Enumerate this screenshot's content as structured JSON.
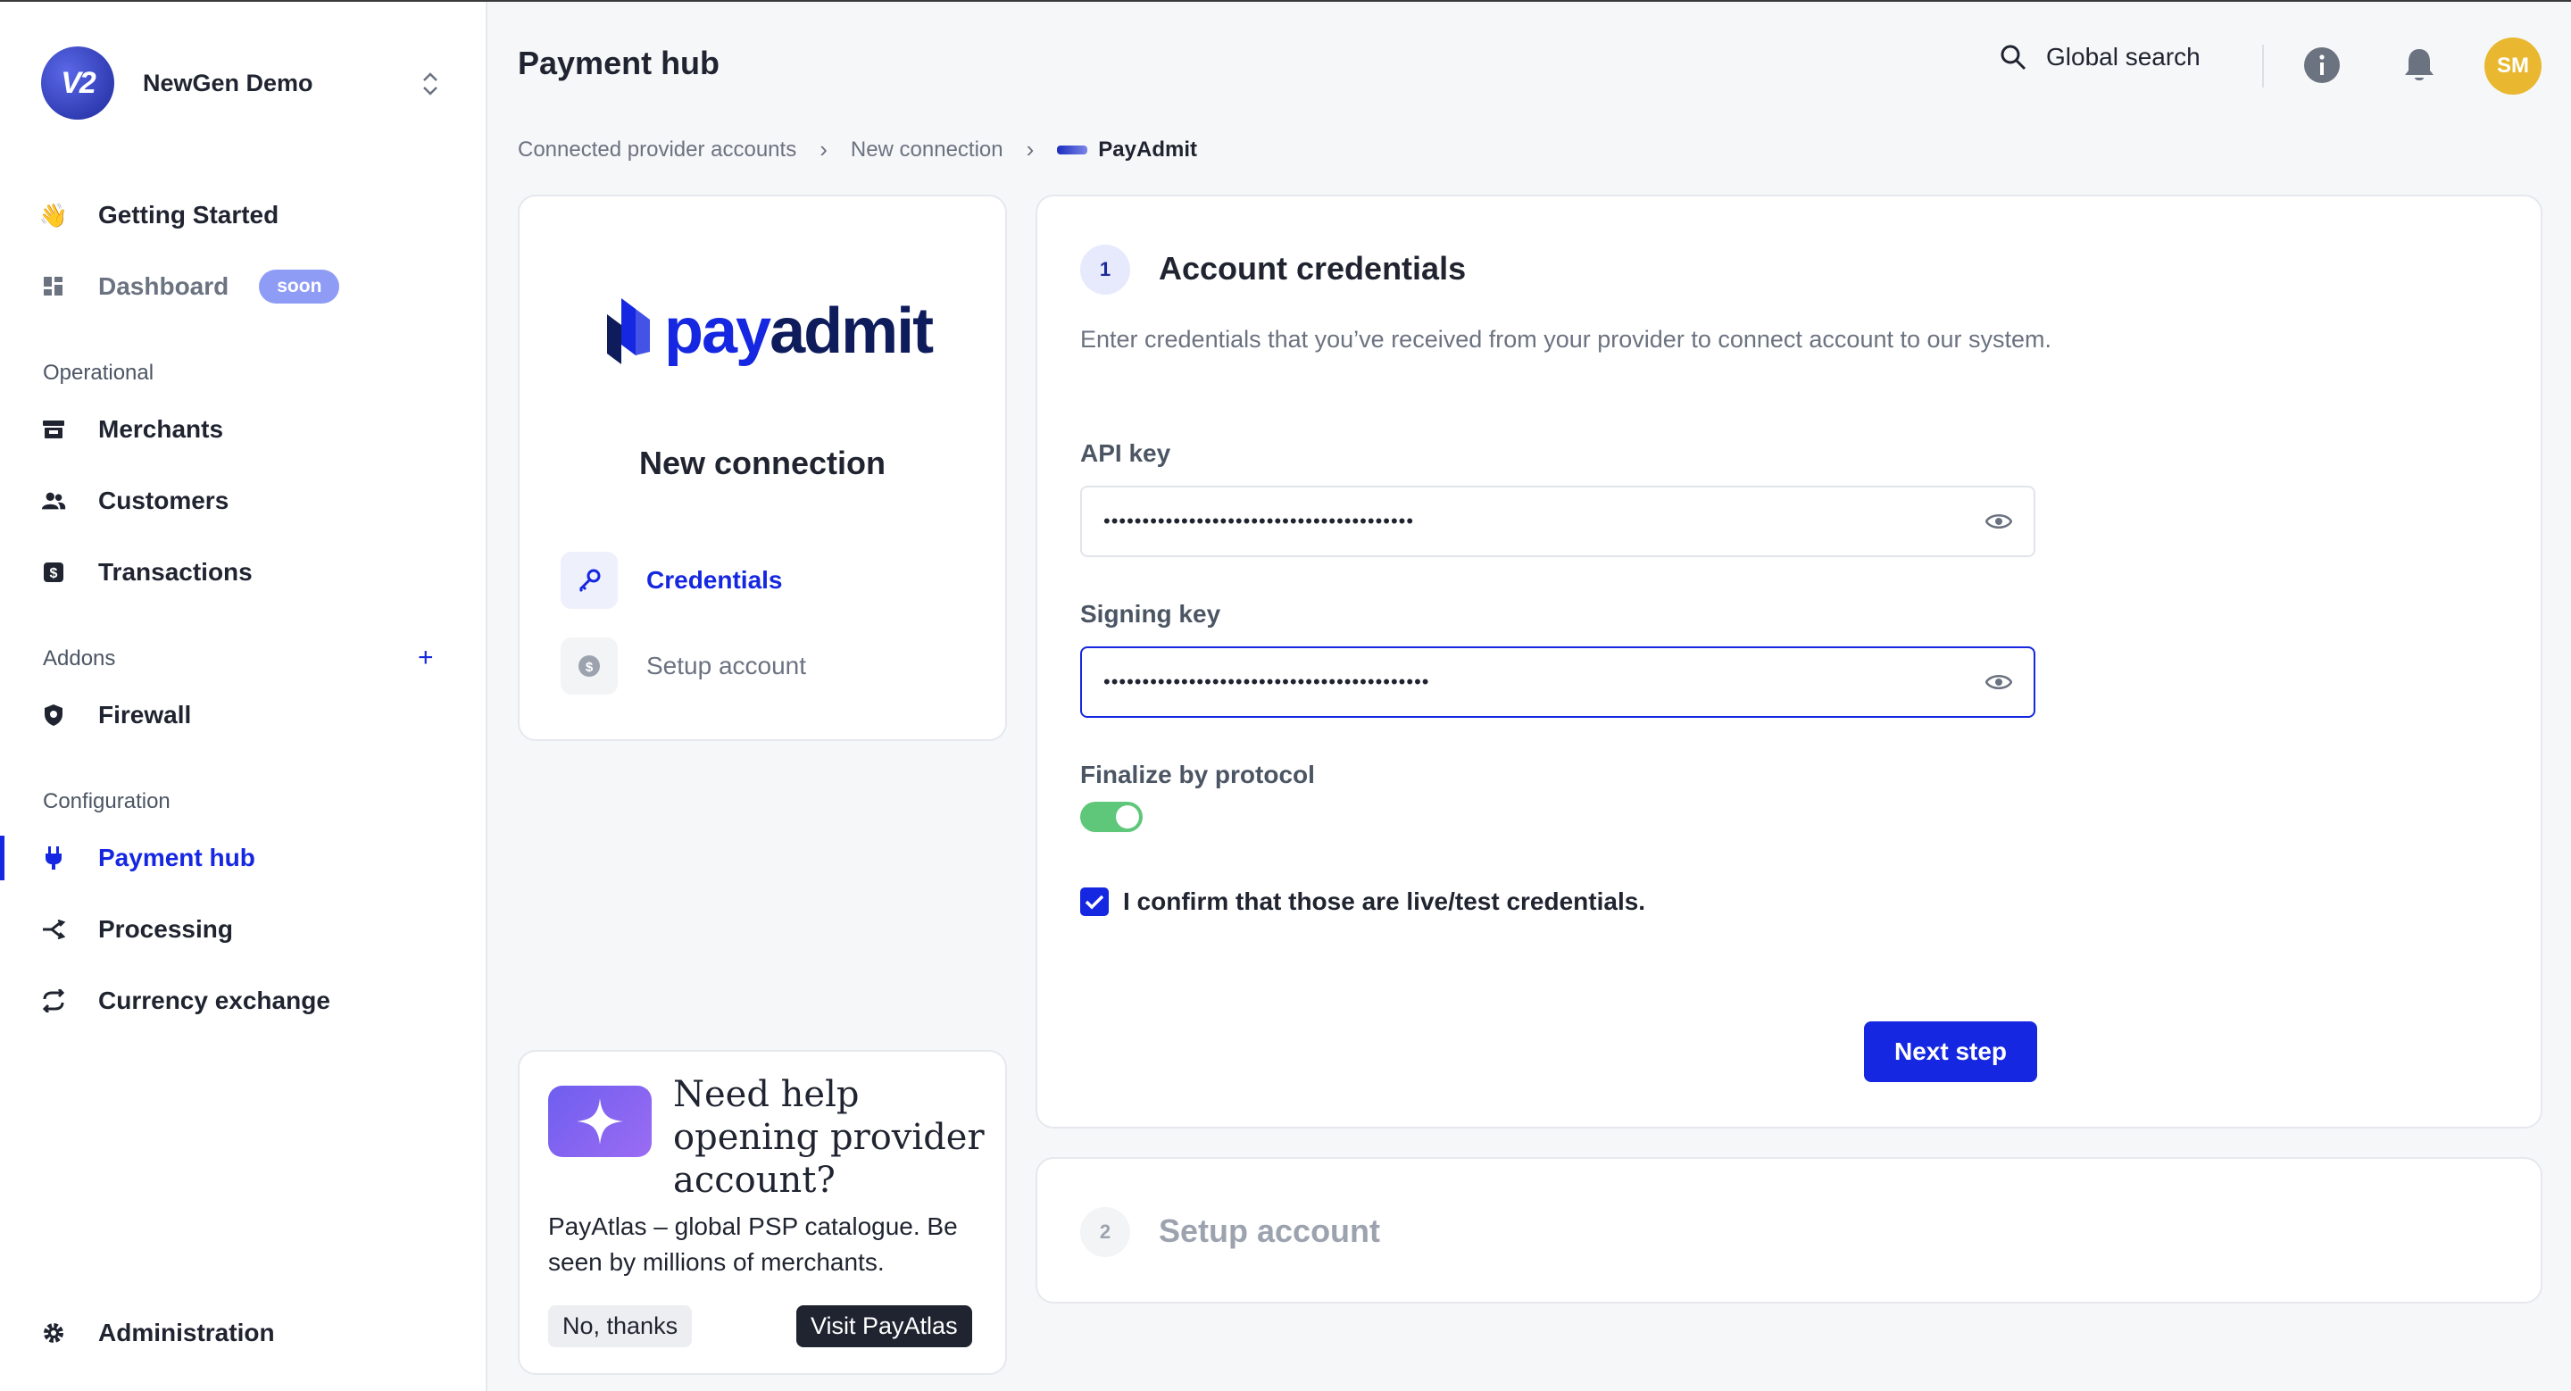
{
  "org": {
    "name": "NewGen Demo",
    "logo_text": "V2"
  },
  "sidebar": {
    "top": [
      {
        "label": "Getting Started"
      },
      {
        "label": "Dashboard",
        "badge": "soon"
      }
    ],
    "sections": {
      "operational": "Operational",
      "addons": "Addons",
      "configuration": "Configuration"
    },
    "operational": [
      "Merchants",
      "Customers",
      "Transactions"
    ],
    "addons": [
      "Firewall"
    ],
    "configuration": [
      "Payment hub",
      "Processing",
      "Currency exchange"
    ],
    "bottom": "Administration",
    "addons_add": "+"
  },
  "header": {
    "title": "Payment hub",
    "search_label": "Global search",
    "avatar": "SM"
  },
  "breadcrumb": [
    "Connected provider accounts",
    "New connection",
    "PayAdmit"
  ],
  "provider_card": {
    "brand_part1": "pay",
    "brand_part2": "admit",
    "title": "New connection",
    "steps": [
      "Credentials",
      "Setup account"
    ]
  },
  "help_card": {
    "title": "Need help opening provider account?",
    "text": "PayAtlas – global PSP catalogue. Be seen by millions of merchants.",
    "dismiss": "No, thanks",
    "visit": "Visit PayAtlas"
  },
  "form": {
    "step1_num": "1",
    "step1_title": "Account credentials",
    "description": "Enter credentials that you’ve received from your provider to connect account to our system.",
    "api_key_label": "API key",
    "api_key_value": "••••••••••••••••••••••••••••••••••••••••",
    "signing_key_label": "Signing key",
    "signing_key_value": "••••••••••••••••••••••••••••••••••••••••••",
    "finalize_label": "Finalize by protocol",
    "finalize_on": true,
    "confirm_label": "I confirm that those are live/test credentials.",
    "confirm_checked": true,
    "next_button": "Next step",
    "step2_num": "2",
    "step2_title": "Setup account"
  },
  "colors": {
    "accent": "#1527e0",
    "toggle_on": "#5ec779",
    "avatar": "#e9b830"
  }
}
